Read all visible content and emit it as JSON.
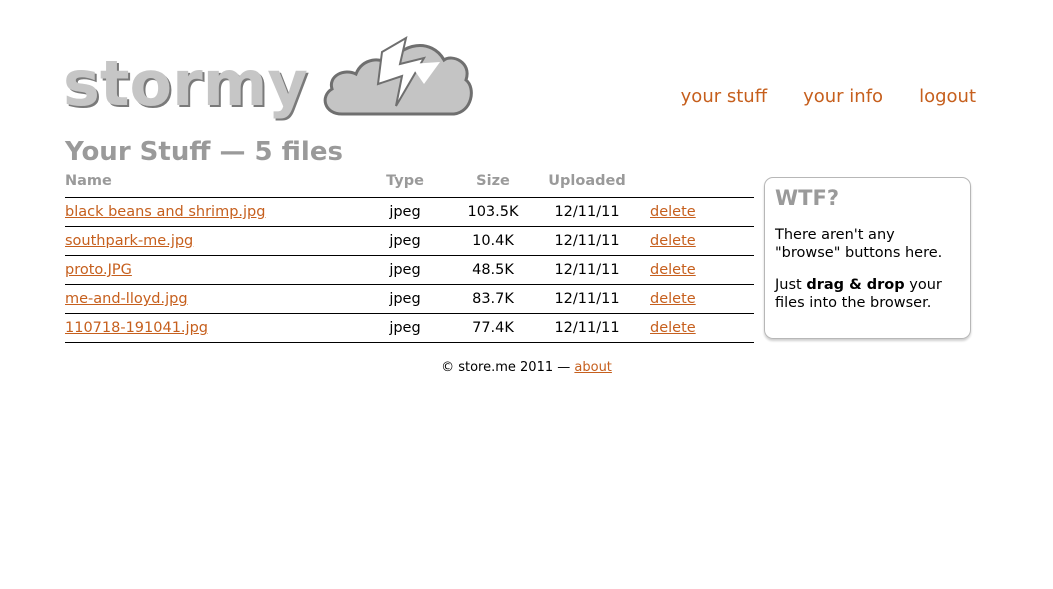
{
  "brand": {
    "logo_text": "stormy",
    "logo_icon": "storm-cloud-lightning-icon"
  },
  "nav": [
    {
      "label": "your stuff"
    },
    {
      "label": "your info"
    },
    {
      "label": "logout"
    }
  ],
  "page_title": "Your Stuff — 5 files",
  "table": {
    "headers": {
      "name": "Name",
      "type": "Type",
      "size": "Size",
      "uploaded": "Uploaded"
    },
    "rows": [
      {
        "name": "black beans and shrimp.jpg",
        "type": "jpeg",
        "size": "103.5K",
        "uploaded": "12/11/11",
        "action": "delete"
      },
      {
        "name": "southpark-me.jpg",
        "type": "jpeg",
        "size": "10.4K",
        "uploaded": "12/11/11",
        "action": "delete"
      },
      {
        "name": "proto.JPG",
        "type": "jpeg",
        "size": "48.5K",
        "uploaded": "12/11/11",
        "action": "delete"
      },
      {
        "name": "me-and-lloyd.jpg",
        "type": "jpeg",
        "size": "83.7K",
        "uploaded": "12/11/11",
        "action": "delete"
      },
      {
        "name": "110718-191041.jpg",
        "type": "jpeg",
        "size": "77.4K",
        "uploaded": "12/11/11",
        "action": "delete"
      }
    ]
  },
  "sidebar": {
    "title": "WTF?",
    "para1": "There aren't any \"browse\" buttons here.",
    "para2_prefix": "Just ",
    "para2_bold": "drag & drop",
    "para2_suffix": " your files into the browser."
  },
  "footer": {
    "copyright": "© store.me 2011 — ",
    "about_label": "about"
  },
  "colors": {
    "accent": "#c65f1d",
    "heading_gray": "#9a9a9a",
    "logo_gray": "#c6c6c6"
  }
}
